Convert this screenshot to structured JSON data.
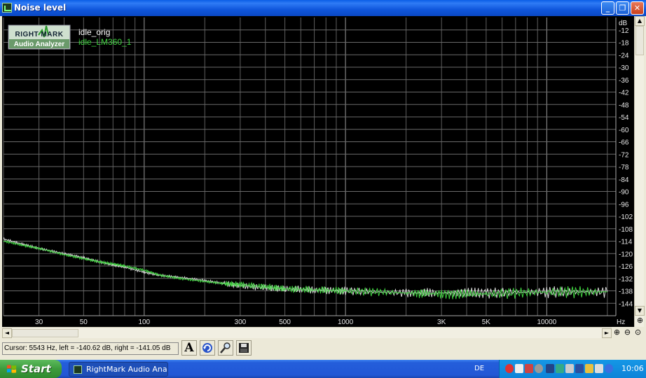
{
  "window": {
    "title": "Noise level",
    "controls": {
      "minimize": "_",
      "maximize": "❐",
      "close": "✕"
    }
  },
  "logo": {
    "line1": "RIGHT MARK",
    "line2": "Audio Analyzer"
  },
  "chart_data": {
    "type": "line",
    "title": "",
    "xlabel": "Hz",
    "ylabel": "dB",
    "x_scale": "log",
    "xlim": [
      20,
      22050
    ],
    "ylim": [
      -150,
      -6
    ],
    "x_ticks": [
      30,
      50,
      100,
      300,
      500,
      1000,
      3000,
      5000,
      10000
    ],
    "x_tick_labels": [
      "30",
      "50",
      "100",
      "300",
      "500",
      "1000",
      "3K",
      "5K",
      "10000"
    ],
    "y_ticks": [
      -12,
      -18,
      -24,
      -30,
      -36,
      -42,
      -48,
      -54,
      -60,
      -66,
      -72,
      -78,
      -84,
      -90,
      -96,
      -102,
      -108,
      -114,
      -120,
      -126,
      -132,
      -138,
      -144
    ],
    "grid": true,
    "legend_position": "top-left",
    "series": [
      {
        "name": "idle_orig",
        "color": "#d8d8d8",
        "x": [
          20,
          25,
          30,
          40,
          50,
          60,
          70,
          80,
          100,
          120,
          150,
          200,
          250,
          300,
          400,
          500,
          700,
          1000,
          2000,
          3000,
          5000,
          10000,
          20000
        ],
        "y": [
          -113,
          -115.5,
          -117.5,
          -120,
          -122,
          -124,
          -125.5,
          -126.5,
          -129,
          -130.5,
          -131.5,
          -133,
          -134.5,
          -135.5,
          -136.5,
          -137,
          -137.5,
          -138,
          -139,
          -139,
          -139,
          -138.5,
          -138.5
        ]
      },
      {
        "name": "idle_LM360_1",
        "color": "#3fd23f",
        "x": [
          20,
          25,
          30,
          40,
          50,
          60,
          70,
          80,
          100,
          120,
          150,
          200,
          250,
          300,
          400,
          500,
          700,
          1000,
          2000,
          3000,
          5000,
          10000,
          20000
        ],
        "y": [
          -114,
          -116,
          -117.5,
          -120.5,
          -122.5,
          -124,
          -125,
          -126,
          -128,
          -130.5,
          -132,
          -133.5,
          -134.5,
          -135,
          -136,
          -137,
          -137.5,
          -138,
          -139,
          -139.5,
          -139.5,
          -138.5,
          -138.5
        ]
      }
    ]
  },
  "status": {
    "cursor_readout": "Cursor:  5543 Hz,  left = -140.62 dB,  right = -141.05 dB"
  },
  "toolbar": {
    "font_button": "A",
    "refresh_icon": "refresh-icon",
    "zoom_tool_icon": "magnifier-icon",
    "save_icon": "floppy-disk-icon"
  },
  "scroll": {
    "up": "▲",
    "down": "▼",
    "left": "◄",
    "right": "►"
  },
  "zoom_controls": {
    "zoom_in": "⊕",
    "zoom_out": "⊖",
    "zoom_fit": "⊙"
  },
  "taskbar": {
    "start_label": "Start",
    "task_label": "RightMark Audio Anal...",
    "language": "DE",
    "clock": "10:06"
  }
}
